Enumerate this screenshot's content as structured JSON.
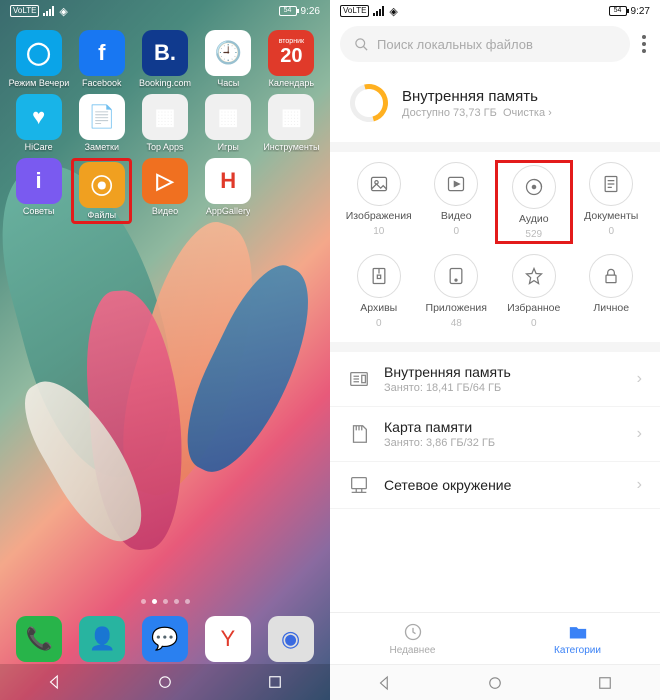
{
  "left": {
    "status": {
      "volte": "VoLTE",
      "battery": "54",
      "time": "9:26"
    },
    "apps_row1": [
      {
        "name": "cortana",
        "label": "Режим Вечеринка",
        "bg": "#0aa4e8",
        "glyph": "◯"
      },
      {
        "name": "facebook",
        "label": "Facebook",
        "bg": "#1877f2",
        "glyph": "f"
      },
      {
        "name": "booking",
        "label": "Booking.com",
        "bg": "#103a8e",
        "glyph": "B."
      },
      {
        "name": "clock",
        "label": "Часы",
        "bg": "#ffffff",
        "glyph": "🕘"
      },
      {
        "name": "calendar",
        "label": "Календарь",
        "bg": "#e03a2a",
        "glyph": "20",
        "sub": "вторник"
      }
    ],
    "apps_row2": [
      {
        "name": "hicare",
        "label": "HiCare",
        "bg": "#18b4e8",
        "glyph": "♥"
      },
      {
        "name": "notes",
        "label": "Заметки",
        "bg": "#ffffff",
        "glyph": "📄"
      },
      {
        "name": "topapps",
        "label": "Top Apps",
        "bg": "#f0f0f0",
        "glyph": "▦"
      },
      {
        "name": "games",
        "label": "Игры",
        "bg": "#f0f0f0",
        "glyph": "▦"
      },
      {
        "name": "tools",
        "label": "Инструменты",
        "bg": "#f0f0f0",
        "glyph": "▦"
      }
    ],
    "apps_row3": [
      {
        "name": "tips",
        "label": "Советы",
        "bg": "#7a5af0",
        "glyph": "i"
      },
      {
        "name": "files",
        "label": "Файлы",
        "bg": "#f0a020",
        "glyph": "⦿",
        "hl": true
      },
      {
        "name": "video",
        "label": "Видео",
        "bg": "#f07020",
        "glyph": "▷"
      },
      {
        "name": "appgallery",
        "label": "AppGallery",
        "bg": "#ffffff",
        "glyph": "H",
        "fg": "#e03a2a"
      }
    ],
    "dock": [
      {
        "name": "phone",
        "bg": "#28b44a",
        "glyph": "📞"
      },
      {
        "name": "contacts",
        "bg": "#28b4a0",
        "glyph": "👤"
      },
      {
        "name": "messages",
        "bg": "#2a80f0",
        "glyph": "💬"
      },
      {
        "name": "yandex",
        "bg": "#ffffff",
        "glyph": "Y",
        "fg": "#e03a2a"
      },
      {
        "name": "camera",
        "bg": "#e0e0e0",
        "glyph": "◉",
        "fg": "#3a6ae0"
      }
    ]
  },
  "right": {
    "status": {
      "volte": "VoLTE",
      "battery": "54",
      "time": "9:27"
    },
    "search_placeholder": "Поиск локальных файлов",
    "storage": {
      "title": "Внутренняя память",
      "subtitle": "Доступно 73,73 ГБ",
      "clean": "Очистка"
    },
    "cats": [
      {
        "key": "images",
        "label": "Изображения",
        "count": "10",
        "icon": "image"
      },
      {
        "key": "video",
        "label": "Видео",
        "count": "0",
        "icon": "play"
      },
      {
        "key": "audio",
        "label": "Аудио",
        "count": "529",
        "icon": "disc",
        "hl": true
      },
      {
        "key": "docs",
        "label": "Документы",
        "count": "0",
        "icon": "doc"
      },
      {
        "key": "archives",
        "label": "Архивы",
        "count": "0",
        "icon": "zip"
      },
      {
        "key": "apps",
        "label": "Приложения",
        "count": "48",
        "icon": "app"
      },
      {
        "key": "fav",
        "label": "Избранное",
        "count": "0",
        "icon": "star"
      },
      {
        "key": "private",
        "label": "Личное",
        "count": "",
        "icon": "lock"
      }
    ],
    "list": [
      {
        "key": "internal",
        "title": "Внутренняя память",
        "sub": "Занято: 18,41 ГБ/64 ГБ"
      },
      {
        "key": "sd",
        "title": "Карта памяти",
        "sub": "Занято: 3,86 ГБ/32 ГБ"
      },
      {
        "key": "net",
        "title": "Сетевое окружение",
        "sub": ""
      }
    ],
    "tabs": {
      "recent": "Недавнее",
      "categories": "Категории"
    }
  }
}
